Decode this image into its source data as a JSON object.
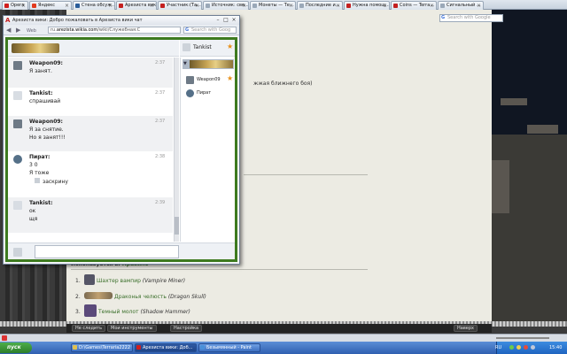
{
  "browser": {
    "tabs": [
      {
        "label": "Opera",
        "color": "#d01e1e"
      },
      {
        "label": "Яндекс",
        "color": "#e23a1e"
      },
      {
        "label": "Стена обсуж...",
        "color": "#2a5d9a"
      },
      {
        "label": "Арезиста вики...",
        "color": "#c42020"
      },
      {
        "label": "Участник:(Та...",
        "color": "#c42020"
      },
      {
        "label": "Источник: све...",
        "color": "#9aa8b8"
      },
      {
        "label": "Монеты — Те...",
        "color": "#9aa8b8"
      },
      {
        "label": "Последние и...",
        "color": "#9aa8b8"
      },
      {
        "label": "Нужна помощ...",
        "color": "#c42020"
      },
      {
        "label": "Coins — Terra...",
        "color": "#c42020"
      },
      {
        "label": "Сигнальный ...",
        "color": "#9aa8b8"
      }
    ],
    "search_placeholder": "Search with Google"
  },
  "chat": {
    "window_title": "Арезиста вики: Добро пожаловать в Арезиста вики чат",
    "logo_letter": "A",
    "nav": {
      "web_label": "Web",
      "url_prefix": "ru.",
      "url_domain": "arezista.wikia.com",
      "url_path": "/wiki/Служебная:C"
    },
    "search_placeholder": "Search with Goog",
    "self_user": "Tankist",
    "messages": [
      {
        "author": "Weapon09:",
        "time": "2:37",
        "lines": [
          "Я занят."
        ]
      },
      {
        "author": "Tankist:",
        "time": "2:37",
        "lines": [
          "спрашивай"
        ]
      },
      {
        "author": "Weapon09:",
        "time": "2:37",
        "lines": [
          "Я за снятие.",
          "Но я занят!!!"
        ]
      },
      {
        "author": "Пират:",
        "time": "2:38",
        "lines": [
          "3 0",
          "Я тоже",
          "заскрину"
        ]
      },
      {
        "author": "Tankist:",
        "time": "2:39",
        "lines": [
          "ок",
          "щя"
        ]
      }
    ],
    "users": [
      "Weapon09",
      "Пират"
    ],
    "input_value": ""
  },
  "wiki_page": {
    "right_text": "жжая ближнего боя)",
    "section_label": "Используется в:",
    "section_link": "Правило",
    "items": [
      {
        "num": "1.",
        "link": "Шахтер вампир",
        "en": "(Vampire Miner)"
      },
      {
        "num": "2.",
        "link": "Драконья челюсть",
        "en": "(Dragon Skull)"
      },
      {
        "num": "3.",
        "link": "Темный молот",
        "en": "(Shadow Hammer)"
      }
    ],
    "toolbar": {
      "follow": "Не следить",
      "my_tools": "Мои инструменты",
      "settings": "Настройка",
      "top": "Наверх"
    }
  },
  "taskbar": {
    "start_label": "пуск",
    "buttons": [
      {
        "label": "D:\\Games\\Terraria2222",
        "color": "#e0c050"
      },
      {
        "label": "Арезиста вики: Доб...",
        "color": "#d01e1e"
      },
      {
        "label": "Безымянный - Paint",
        "color": "#4a90d9"
      }
    ],
    "lang": "RU",
    "clock": "15:40"
  }
}
